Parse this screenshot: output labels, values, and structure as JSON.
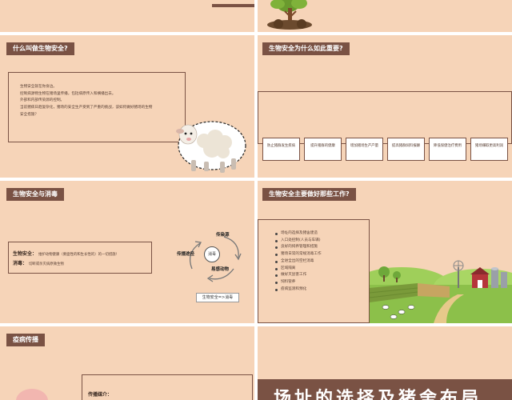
{
  "slides": {
    "biosafety_definition": {
      "title": "什么叫做生物安全?",
      "lines": [
        "生物安全就在你身边。",
        "控制病源物生物在猪场里传播，包括病原传入和横播出去。",
        "外部和内部传染源的控制。",
        "当前猪病日趋复杂化，猪场的安全生产受到了严重的挑战，该如何做好猪场的生物",
        "安全措施？"
      ]
    },
    "why_important": {
      "title": "生物安全为什么如此重要?",
      "reasons": [
        "防止猪群发生疾病",
        "提升猪群的健康",
        "增加猪场生产产量",
        "提高猪群饲料报酬",
        "降低保健治疗费用",
        "猪场赚取更高利润"
      ]
    },
    "disinfection": {
      "title": "生物安全与消毒",
      "def_label_1": "生物安全：",
      "def_text_1": "维护动物健康（要面性的和生长性的）的一切措施!",
      "def_label_2": "消毒：",
      "def_text_2": "切断或杀灭病原微生物",
      "cycle": {
        "center": "消毒",
        "top": "传染源",
        "left": "传播途径",
        "bottom": "易感动物"
      },
      "formula": "生物安全=>消毒"
    },
    "main_work": {
      "title": "生物安全主要做好那些工作?",
      "items": [
        "场址的选择及猪舍建造",
        "入口处控制(人员与车辆)",
        "良好的饲养管理和措施",
        "猪场日常的常规消毒工作",
        "全进全出的空栏消毒",
        "区域隔离",
        "做好灭鼠害工作",
        "饲料管养",
        "疫病监测和预化"
      ]
    },
    "transmission": {
      "title": "疫病传播",
      "sub_label": "传播媒介："
    },
    "site_selection": {
      "banner": "场址的选择及猪舍布局"
    }
  },
  "colors": {
    "panel_bg": "#f6d4b8",
    "tag_bg": "#7a5244",
    "border": "#7a5244",
    "grass": "#8cc04a",
    "barn_red": "#b5353a"
  }
}
